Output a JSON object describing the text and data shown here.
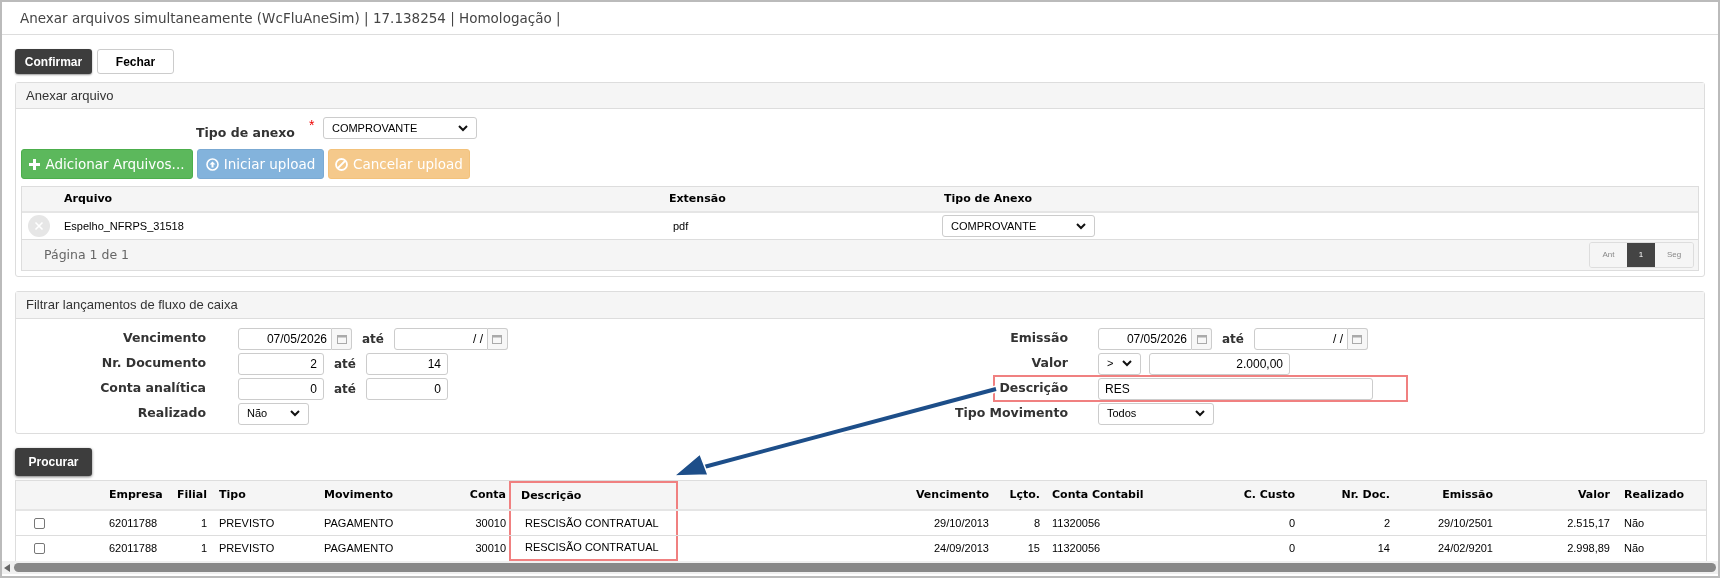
{
  "window": {
    "title": "Anexar arquivos simultaneamente (WcFluAneSim) | 17.138254 | Homologação |"
  },
  "toolbar": [
    {
      "label": "Confirmar",
      "kind": "primary"
    },
    {
      "label": "Fechar",
      "kind": "default"
    }
  ],
  "attach_panel": {
    "title": "Anexar arquivo",
    "attachment_type": {
      "label": "Tipo de anexo",
      "required_mark": "*",
      "value": "COMPROVANTE"
    },
    "buttons": [
      {
        "label": "Adicionar Arquivos...",
        "kind": "add",
        "disabled": false
      },
      {
        "label": "Iniciar upload",
        "kind": "upload",
        "disabled": true
      },
      {
        "label": "Cancelar upload",
        "kind": "cancel",
        "disabled": true
      }
    ],
    "files": {
      "columns": [
        "Arquivo",
        "Extensão",
        "Tipo de Anexo"
      ],
      "rows": [
        {
          "name": "Espelho_NFRPS_31518",
          "extension": "pdf",
          "type": "COMPROVANTE"
        }
      ]
    },
    "pagination": {
      "summary": "Página 1 de 1",
      "prev": "Ant",
      "pages": [
        {
          "label": "1",
          "selected": true
        }
      ],
      "next": "Seg"
    }
  },
  "filter": {
    "title": "Filtrar lançamentos de fluxo de caixa",
    "left": [
      {
        "kind": "date-range",
        "label": "Vencimento",
        "from": "07/05/2026",
        "separator": "até",
        "to": "/ /",
        "highlighted": false
      },
      {
        "kind": "number-range",
        "label": "Nr. Documento",
        "from": "2",
        "separator": "até",
        "to": "14",
        "highlighted": false
      },
      {
        "kind": "number-range",
        "label": "Conta analítica",
        "from": "0",
        "separator": "até",
        "to": "0",
        "highlighted": false
      },
      {
        "kind": "select",
        "label": "Realizado",
        "value": "Não",
        "highlighted": false
      }
    ],
    "right": [
      {
        "kind": "date-range",
        "label": "Emissão",
        "from": "07/05/2026",
        "separator": "até",
        "to": "/ /",
        "highlighted": false
      },
      {
        "kind": "compare",
        "label": "Valor",
        "operator": ">",
        "value": "2.000,00",
        "highlighted": false
      },
      {
        "kind": "text",
        "label": "Descrição",
        "value": "RES",
        "highlighted": true
      },
      {
        "kind": "select",
        "label": "Tipo Movimento",
        "value": "Todos",
        "highlighted": false
      }
    ]
  },
  "search_button": "Procurar",
  "results": {
    "columns": [
      {
        "label": "Empresa",
        "highlighted": false
      },
      {
        "label": "Filial",
        "highlighted": false
      },
      {
        "label": "Tipo",
        "highlighted": false
      },
      {
        "label": "Movimento",
        "highlighted": false
      },
      {
        "label": "Conta",
        "highlighted": false
      },
      {
        "label": "Descrição",
        "highlighted": true
      },
      {
        "label": "Vencimento",
        "highlighted": false
      },
      {
        "label": "Lçto.",
        "highlighted": false
      },
      {
        "label": "Conta Contabil",
        "highlighted": false
      },
      {
        "label": "C. Custo",
        "highlighted": false
      },
      {
        "label": "Nr. Doc.",
        "highlighted": false
      },
      {
        "label": "Emissão",
        "highlighted": false
      },
      {
        "label": "Valor",
        "highlighted": false
      },
      {
        "label": "Realizado",
        "highlighted": false
      }
    ],
    "rows": [
      {
        "checked": false,
        "cells": [
          "62011788",
          "1",
          "PREVISTO",
          "PAGAMENTO",
          "30010",
          "RESCISÃO CONTRATUAL",
          "29/10/2013",
          "8",
          "11320056",
          "0",
          "2",
          "29/10/2501",
          "2.515,17",
          "Não"
        ]
      },
      {
        "checked": false,
        "cells": [
          "62011788",
          "1",
          "PREVISTO",
          "PAGAMENTO",
          "30010",
          "RESCISÃO CONTRATUAL",
          "24/09/2013",
          "15",
          "11320056",
          "0",
          "14",
          "24/02/9201",
          "2.998,89",
          "Não"
        ]
      }
    ]
  }
}
